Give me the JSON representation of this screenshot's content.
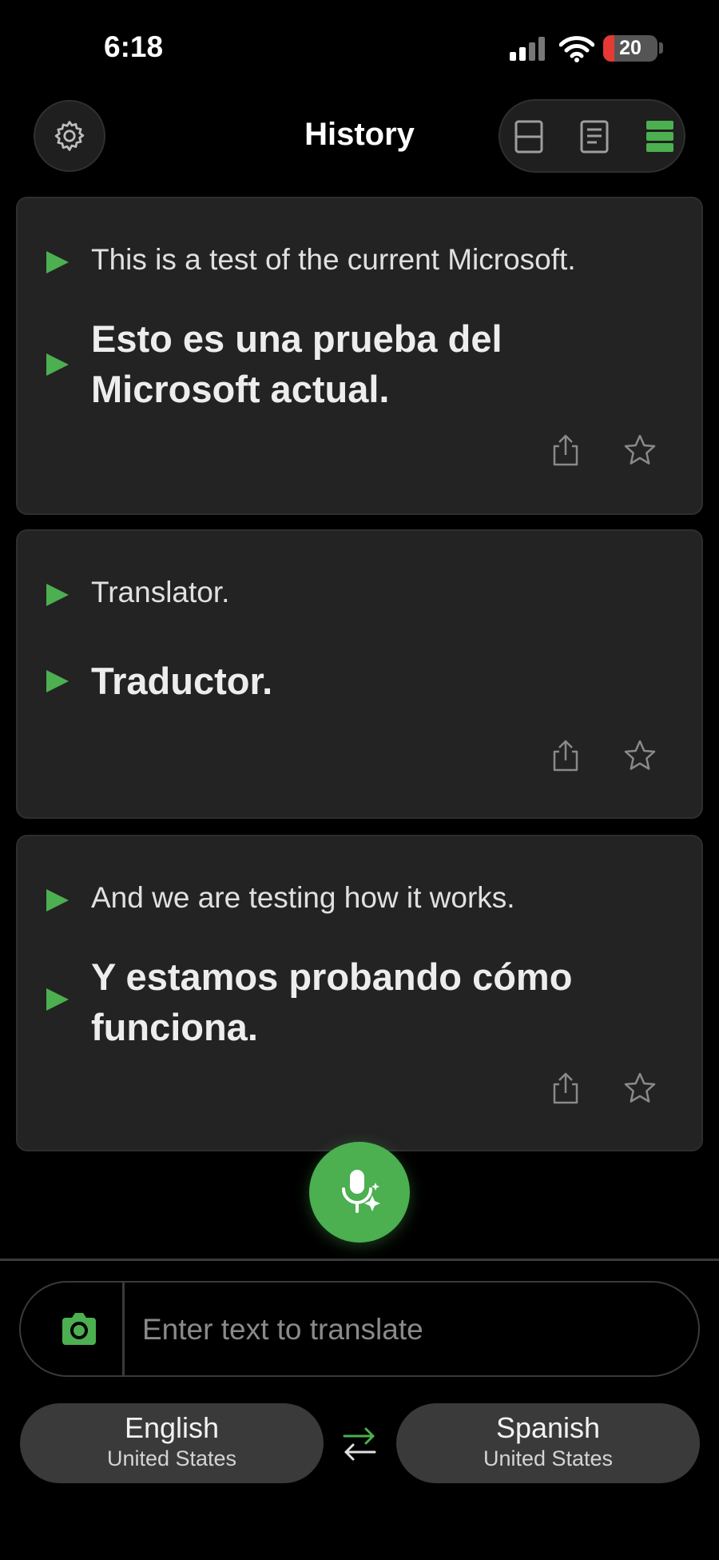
{
  "status_bar": {
    "time": "6:18",
    "battery_level": "20",
    "signal_icon": "cellular-signal-icon",
    "wifi_icon": "wifi-icon"
  },
  "header": {
    "title": "History",
    "settings_icon": "gear-icon",
    "view_modes": [
      {
        "icon": "split-view-icon",
        "active": false
      },
      {
        "icon": "document-view-icon",
        "active": false
      },
      {
        "icon": "list-view-icon",
        "active": true
      }
    ]
  },
  "history": [
    {
      "source": "This is a test of the current Microsoft.",
      "translation": "Esto es una prueba del Microsoft actual."
    },
    {
      "source": "Translator.",
      "translation": "Traductor."
    },
    {
      "source": "And we are testing how it works.",
      "translation": "Y estamos probando cómo funciona."
    }
  ],
  "input": {
    "placeholder": "Enter text to translate",
    "value": ""
  },
  "languages": {
    "source": {
      "name": "English",
      "region": "United States"
    },
    "target": {
      "name": "Spanish",
      "region": "United States"
    }
  },
  "colors": {
    "accent": "#4caf50",
    "background": "#000000",
    "card": "#232323",
    "pill": "#3a3a3a",
    "battery_low": "#e53935"
  }
}
